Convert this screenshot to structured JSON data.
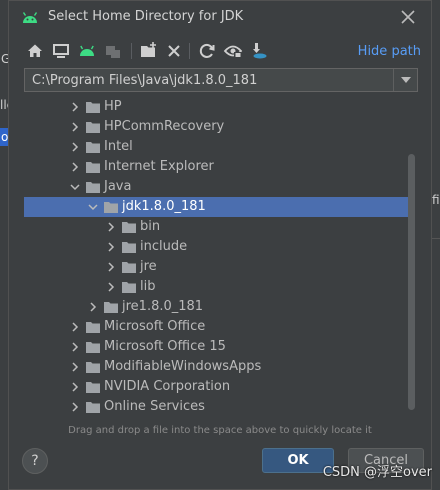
{
  "colors": {
    "accent_link": "#589df6",
    "selection": "#4b6eaf",
    "folder": "#a0a4a8",
    "ok_button": "#365880",
    "android_green": "#3ddc84"
  },
  "background": {
    "right_glyph": "fil",
    "left_glyphs": [
      "lle",
      "G",
      "o"
    ]
  },
  "dialog": {
    "title": "Select Home Directory for JDK",
    "logo_icon": "android-icon",
    "close_icon": "close-icon"
  },
  "toolbar": {
    "hide_path_label": "Hide path",
    "buttons": [
      {
        "name": "home-icon"
      },
      {
        "name": "desktop-icon"
      },
      {
        "name": "project-android-icon"
      },
      {
        "name": "module-icon"
      },
      {
        "name": "new-folder-icon"
      },
      {
        "name": "delete-icon"
      },
      {
        "name": "refresh-icon"
      },
      {
        "name": "show-hidden-icon"
      },
      {
        "name": "sdk-download-icon"
      }
    ]
  },
  "path": {
    "value": "C:\\Program Files\\Java\\jdk1.8.0_181"
  },
  "tree": {
    "items": [
      {
        "label": "HP",
        "expanded": false
      },
      {
        "label": "HPCommRecovery",
        "expanded": false
      },
      {
        "label": "Intel",
        "expanded": false
      },
      {
        "label": "Internet Explorer",
        "expanded": false
      },
      {
        "label": "Java",
        "expanded": true
      },
      {
        "label": "jdk1.8.0_181",
        "expanded": true,
        "selected": true
      },
      {
        "label": "bin",
        "expanded": false
      },
      {
        "label": "include",
        "expanded": false
      },
      {
        "label": "jre",
        "expanded": false
      },
      {
        "label": "lib",
        "expanded": false
      },
      {
        "label": "jre1.8.0_181",
        "expanded": false
      },
      {
        "label": "Microsoft Office",
        "expanded": false
      },
      {
        "label": "Microsoft Office 15",
        "expanded": false
      },
      {
        "label": "ModifiableWindowsApps",
        "expanded": false
      },
      {
        "label": "NVIDIA Corporation",
        "expanded": false
      },
      {
        "label": "Online Services",
        "expanded": false
      }
    ]
  },
  "hint": "Drag and drop a file into the space above to quickly locate it",
  "buttons": {
    "help": "?",
    "ok": "OK",
    "cancel": "Cancel"
  },
  "watermark": "CSDN @浮空over"
}
